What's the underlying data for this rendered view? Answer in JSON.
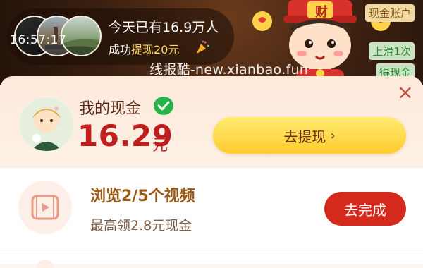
{
  "banner": {
    "clock": "16:57:17",
    "notice_line1": "今天已有16.9万人",
    "notice_line2_prefix": "成功",
    "notice_line2_highlight": "提现20元",
    "watermark": "线报酷-new.xianbao.fun",
    "mascot_badge": "财",
    "side_tags": {
      "top": "现金账户",
      "mid": "上滑1次",
      "bot": "得现金"
    }
  },
  "cash": {
    "label": "我的现金",
    "amount": "16.29",
    "unit": "元",
    "withdraw_label": "去提现",
    "withdraw_chevron": "›",
    "close_glyph": "×"
  },
  "task": {
    "title": "浏览2/5个视频",
    "subtitle": "最高领2.8元现金",
    "button_label": "去完成"
  },
  "colors": {
    "accent_red": "#d42a1e",
    "amount_red": "#c01d1d",
    "gold": "#ffcb2e",
    "wechat_green": "#27b24a"
  }
}
